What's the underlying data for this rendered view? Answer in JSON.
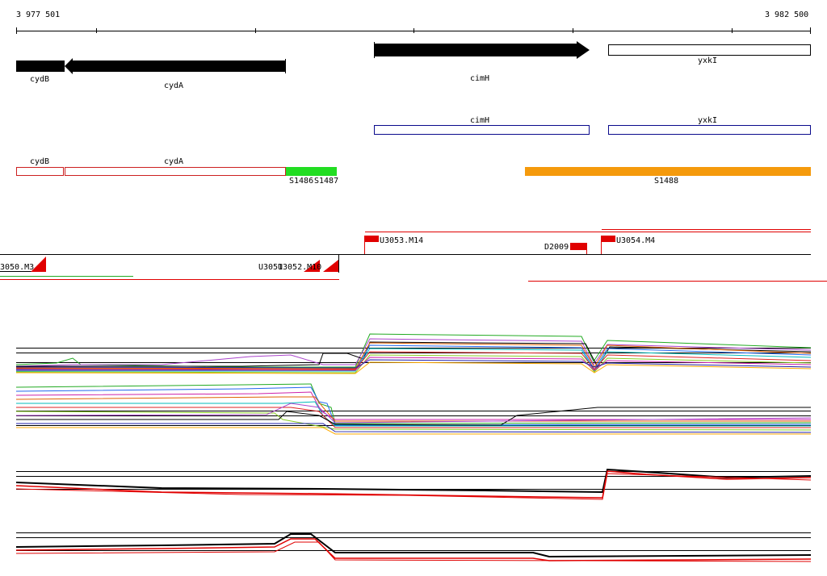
{
  "coords": {
    "start": "3 977 501",
    "end": "3 982 500"
  },
  "genes_top": {
    "cydB": "cydB",
    "cydA": "cydA",
    "cimH": "cimH",
    "yxkI": "yxkI"
  },
  "genes_blue": {
    "cimH": "cimH",
    "yxkI": "yxkI"
  },
  "genes_red": {
    "cydB": "cydB",
    "cydA": "cydA"
  },
  "segments": {
    "s1486": "S1486",
    "s1487": "S1487",
    "s1488": "S1488"
  },
  "tus": {
    "u3053": "U3053.M14",
    "u3054": "U3054.M4",
    "d2009": "D2009",
    "u3050": "3050.M3",
    "u3051": "U3051",
    "u3052": "U3052.M10"
  },
  "colors": {
    "gene_fill": "#000000",
    "gene_outline_blue": "#0a0a8c",
    "gene_outline_red": "#cc2020",
    "segment_green": "#22dd22",
    "segment_orange": "#f59a0c",
    "tu_red": "#e00000"
  }
}
